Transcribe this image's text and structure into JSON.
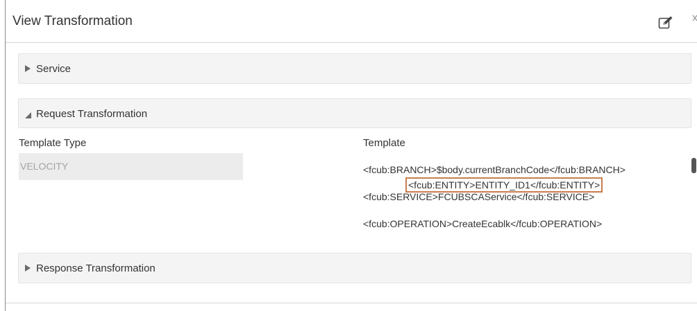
{
  "dialog": {
    "title": "View Transformation"
  },
  "icons": {
    "edit": "edit-icon",
    "close": "close-icon"
  },
  "sections": {
    "service": {
      "label": "Service",
      "expanded": false
    },
    "request": {
      "label": "Request Transformation",
      "expanded": true
    },
    "response": {
      "label": "Response Transformation",
      "expanded": false
    }
  },
  "request_form": {
    "template_type_label": "Template Type",
    "template_type_value": "VELOCITY",
    "template_label": "Template",
    "template_lines": [
      "<fcub:BRANCH>$body.currentBranchCode</fcub:BRANCH>",
      "<fcub:ENTITY>ENTITY_ID1</fcub:ENTITY>",
      "<fcub:SERVICE>FCUBSCAService</fcub:SERVICE>",
      "<fcub:OPERATION>CreateEcablk</fcub:OPERATION>"
    ]
  },
  "colors": {
    "highlight_border": "#c77d4f",
    "panel_bg": "#f4f4f4",
    "readonly_bg": "#ececec"
  }
}
